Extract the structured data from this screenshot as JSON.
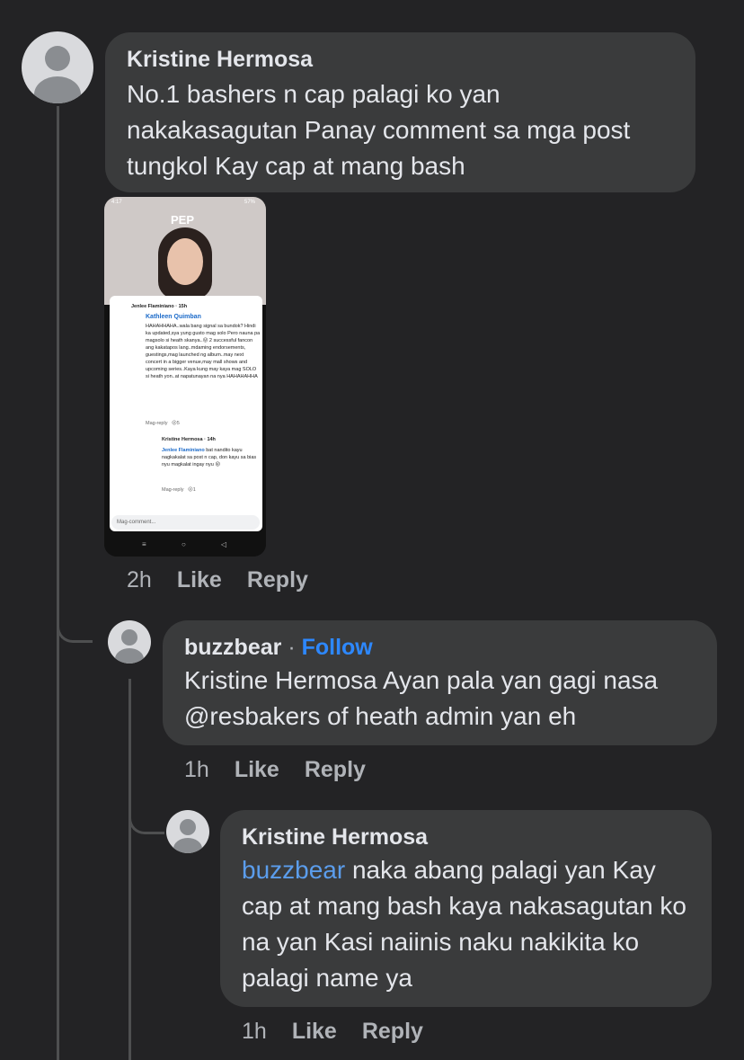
{
  "comments": [
    {
      "author": "Kristine Hermosa",
      "text": "No.1 bashers n cap palagi ko yan nakakasagutan Panay comment sa mga post tungkol Kay cap at mang bash",
      "time": "2h",
      "like": "Like",
      "reply": "Reply"
    },
    {
      "author": "buzzbear",
      "separator": "·",
      "follow": "Follow",
      "text": "Kristine Hermosa Ayan pala yan gagi nasa @resbakers of heath admin yan eh",
      "time": "1h",
      "like": "Like",
      "reply": "Reply"
    },
    {
      "author": "Kristine Hermosa",
      "mention": "buzzbear",
      "text": " naka abang palagi yan Kay cap at mang bash kaya nakasagutan ko na yan Kasi naiinis naku nakikita ko palagi name ya",
      "time": "1h",
      "like": "Like",
      "reply": "Reply"
    }
  ],
  "attachment": {
    "status_time": "4:17",
    "status_battery": "57%",
    "logo": "PEP",
    "c1_author": "Jenlee Flaminiano",
    "c1_time": "15h",
    "c1_mention": "Kathleen Quimban",
    "c1_text": "HAHAHHAHA..wala bang signal sa bundok? Hindi ka updated,sya yung gusto mag solo Pero nauna pa magsolo si heath skanya..😜 2 successful fancon ang kakatapos lang..mdaming endorsements, guestings,mag launched ng album..may next concert in a bigger venue,may mall shows and upcoming series..Kaya kung may kaya mag SOLO si heath yon..at napatunayan na nya HAHAHAHHA",
    "c1_reply": "Mag-reply",
    "c1_count": "5",
    "c2_author": "Kristine Hermosa",
    "c2_time": "14h",
    "c2_mention": "Jenlee Flaminiano",
    "c2_text": " bat nandito kayu nagkakalat sa post n cap, don kayu sa bias nyu magkalat ingay nyu 😜",
    "c2_reply": "Mag-reply",
    "c2_count": "1",
    "input_placeholder": "Mag-comment..."
  }
}
